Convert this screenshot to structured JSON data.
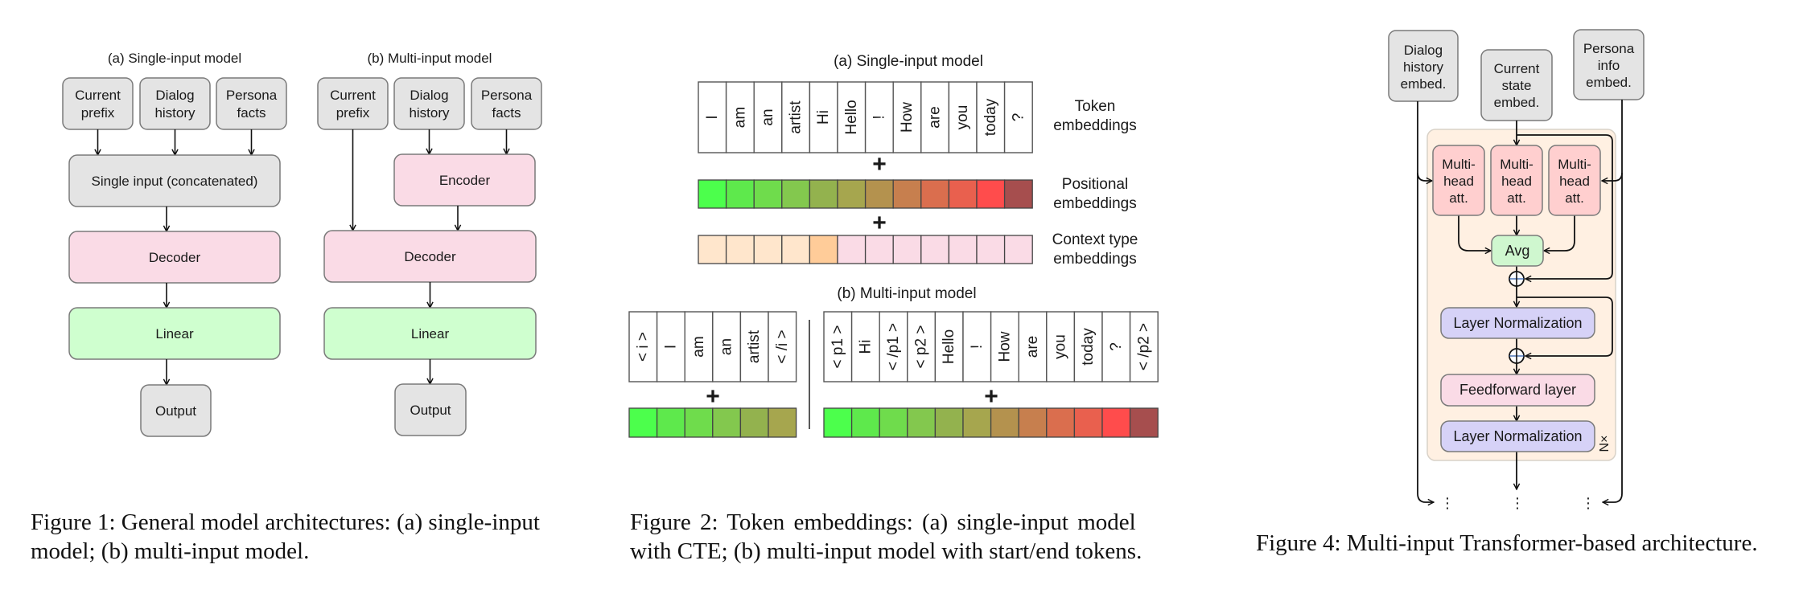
{
  "figure1": {
    "panel_a": {
      "title": "(a) Single-input model",
      "inputs": [
        {
          "lines": [
            "Current",
            "prefix"
          ]
        },
        {
          "lines": [
            "Dialog",
            "history"
          ]
        },
        {
          "lines": [
            "Persona",
            "facts"
          ]
        }
      ],
      "concat": "Single input (concatenated)",
      "decoder": "Decoder",
      "linear": "Linear",
      "output": "Output"
    },
    "panel_b": {
      "title": "(b) Multi-input model",
      "inputs": [
        {
          "lines": [
            "Current",
            "prefix"
          ]
        },
        {
          "lines": [
            "Dialog",
            "history"
          ]
        },
        {
          "lines": [
            "Persona",
            "facts"
          ]
        }
      ],
      "encoder": "Encoder",
      "decoder": "Decoder",
      "linear": "Linear",
      "output": "Output"
    },
    "caption": "Figure 1: General model architectures: (a) single-input model; (b) multi-input model.",
    "caption_lines": [
      "Figure 1: General model architectures: (a) single-input",
      "model; (b) multi-input model."
    ]
  },
  "figure2": {
    "panel_a": {
      "title": "(a) Single-input model",
      "tokens": [
        "I",
        "am",
        "an",
        "artist",
        "Hi",
        "Hello",
        "!",
        "How",
        "are",
        "you",
        "today",
        "?"
      ],
      "positional_colors": [
        "#4cff4c",
        "#5ee94c",
        "#6fdc4c",
        "#83c84e",
        "#93b24e",
        "#a6a64e",
        "#b4924e",
        "#c77f4e",
        "#da6e4e",
        "#e9604e",
        "#ff4c4c",
        "#a64e4e"
      ],
      "context_colors": [
        "#ffe6cc",
        "#ffe6cc",
        "#ffe6cc",
        "#ffe6cc",
        "#ffcc99",
        "#fadbe6",
        "#fadbe6",
        "#fadbe6",
        "#fadbe6",
        "#fadbe6",
        "#fadbe6",
        "#fadbe6"
      ],
      "labels": {
        "token": [
          "Token",
          "embeddings"
        ],
        "positional": [
          "Positional",
          "embeddings"
        ],
        "context": [
          "Context type",
          "embeddings"
        ]
      },
      "plus": "+"
    },
    "panel_b": {
      "title": "(b) Multi-input model",
      "left_tokens": [
        "< i >",
        "I",
        "am",
        "an",
        "artist",
        "< /i >"
      ],
      "left_colors": [
        "#4cff4c",
        "#5ee94c",
        "#6fdc4c",
        "#83c84e",
        "#93b24e",
        "#a6a64e"
      ],
      "right_tokens": [
        "< p1 >",
        "Hi",
        "< /p1 >",
        "< p2 >",
        "Hello",
        "!",
        "How",
        "are",
        "you",
        "today",
        "?",
        "< /p2 >"
      ],
      "right_colors": [
        "#4cff4c",
        "#5ee94c",
        "#6fdc4c",
        "#83c84e",
        "#93b24e",
        "#a6a64e",
        "#b4924e",
        "#c77f4e",
        "#da6e4e",
        "#e9604e",
        "#ff4c4c",
        "#a64e4e"
      ],
      "plus": "+"
    },
    "caption_lines": [
      "Figure 2: Token embeddings: (a) single-input model",
      "with CTE; (b) multi-input model with start/end tokens."
    ]
  },
  "figure4": {
    "inputs": {
      "dialog": [
        "Dialog",
        "history",
        "embed."
      ],
      "current": [
        "Current",
        "state",
        "embed."
      ],
      "persona": [
        "Persona",
        "info",
        "embed."
      ]
    },
    "mha": [
      "Multi-",
      "head",
      "att."
    ],
    "avg": "Avg",
    "layer_norm": "Layer Normalization",
    "feedforward": "Feedforward layer",
    "repeat": "N×",
    "continuation": "⋮",
    "caption": "Figure 4: Multi-input Transformer-based architecture."
  },
  "colors": {
    "gray_box": "#e4e4e4",
    "pink_box": "#fadbe6",
    "green_box": "#cfffcf",
    "mha_box": "#ffcfcf",
    "avg_box": "#cff7cf",
    "layernorm_box": "#d6d2f7",
    "container": "#fff0e2",
    "stroke": "#7a7a7a"
  }
}
